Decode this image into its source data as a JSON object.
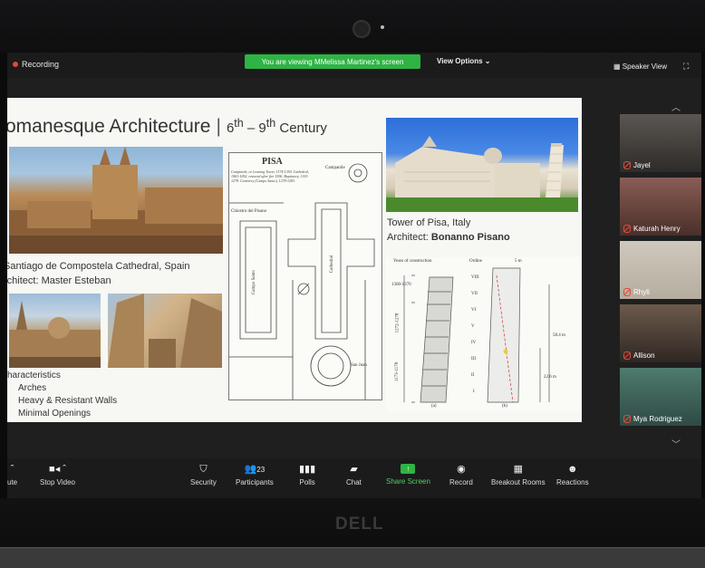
{
  "topbar": {
    "recording": "Recording",
    "viewing": "You are viewing MMelissa Martinez's screen",
    "view_options": "View Options",
    "speaker_view": "Speaker View"
  },
  "slide": {
    "title": "omanesque Architecture",
    "century_start": "6",
    "century_sup1": "th",
    "century_mid": " – 9",
    "century_sup2": "th",
    "century_end": " Century",
    "caption1": "Santiago de Compostela Cathedral, Spain",
    "caption2": "rchitect: Master Esteban",
    "characteristics_title": "haracteristics",
    "characteristics": [
      "Arches",
      "Heavy & Resistant Walls",
      "Minimal Openings"
    ],
    "pisa_caption1": "Tower of Pisa, Italy",
    "pisa_caption2_prefix": "Architect: ",
    "pisa_caption2_name": "Bonanno Pisano",
    "map": {
      "title": "PISA",
      "note": "Campanile, or Leaning Tower, 1174-1350. Cathedral, 1063-1092, restored after fire 1596. Baptistery, 1153-1278. Cemetery (Campo Santo), 1278-1283.",
      "campanile": "Campanile",
      "cathedral": "Cathedral",
      "campo_santo": "Campo Santo",
      "chiostro": "Chiostro del Pisano",
      "san_juan": "San Juan"
    },
    "drawing": {
      "years": "Years of construction",
      "ordine": "Ordine",
      "width": "5 m",
      "height": "58.4 m",
      "lower": "22.6 m",
      "y1": "1360-1370",
      "y2": "1272-1278",
      "y3": "1173-1178",
      "levels": [
        "VIII",
        "VII",
        "VI",
        "V",
        "IV",
        "III",
        "II",
        "I"
      ],
      "fig_a": "(a)",
      "fig_b": "(b)"
    }
  },
  "participants_panel": [
    {
      "name": "Jayel"
    },
    {
      "name": "Katurah Henry"
    },
    {
      "name": "Rhyli"
    },
    {
      "name": "Allison"
    },
    {
      "name": "Mya Rodriguez"
    }
  ],
  "toolbar": {
    "unmute": "ute",
    "stop_video": "Stop Video",
    "security": "Security",
    "participants": "Participants",
    "participants_count": "23",
    "polls": "Polls",
    "chat": "Chat",
    "share_screen": "Share Screen",
    "record": "Record",
    "breakout": "Breakout Rooms",
    "reactions": "Reactions"
  },
  "brand": "DELL",
  "colors": {
    "share_green": "#2fb344",
    "mic_off_red": "#e04a3a"
  }
}
